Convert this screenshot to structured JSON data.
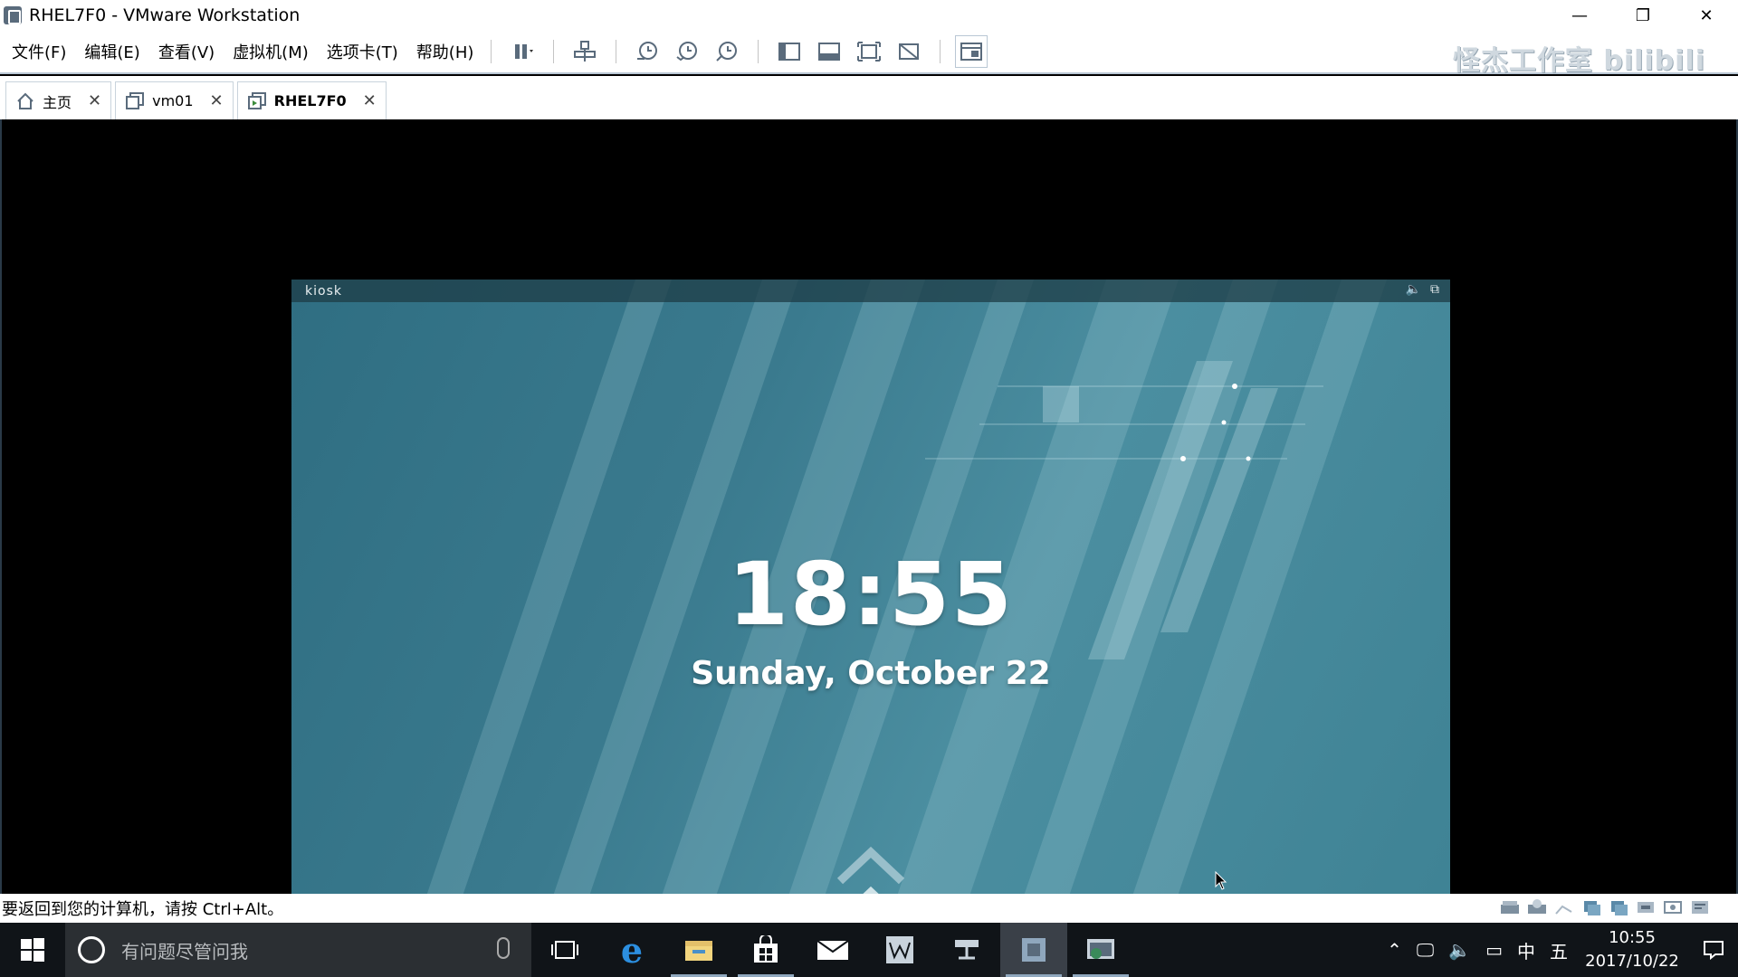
{
  "window": {
    "title": "RHEL7F0 - VMware Workstation",
    "minimize": "—",
    "restore": "❐",
    "close": "✕"
  },
  "menu": [
    "文件(F)",
    "编辑(E)",
    "查看(V)",
    "虚拟机(M)",
    "选项卡(T)",
    "帮助(H)"
  ],
  "watermark": "怪杰工作室 bilibili",
  "tabs": [
    {
      "label": "主页",
      "icon": "home-icon"
    },
    {
      "label": "vm01",
      "icon": "vm-icon"
    },
    {
      "label": "RHEL7F0",
      "icon": "vm-running-icon",
      "active": true
    }
  ],
  "guest": {
    "user": "kiosk",
    "clock": "18:55",
    "date": "Sunday, October 22"
  },
  "status": {
    "message": "要返回到您的计算机，请按 Ctrl+Alt。"
  },
  "taskbar": {
    "search_placeholder": "有问题尽管问我",
    "time": "10:55",
    "date": "2017/10/22",
    "ime_lang": "中",
    "ime_mode": "五"
  },
  "colors": {
    "guest_bg": "#3a7a8e",
    "taskbar_bg": "#101418",
    "accent": "#8fa7bd"
  }
}
